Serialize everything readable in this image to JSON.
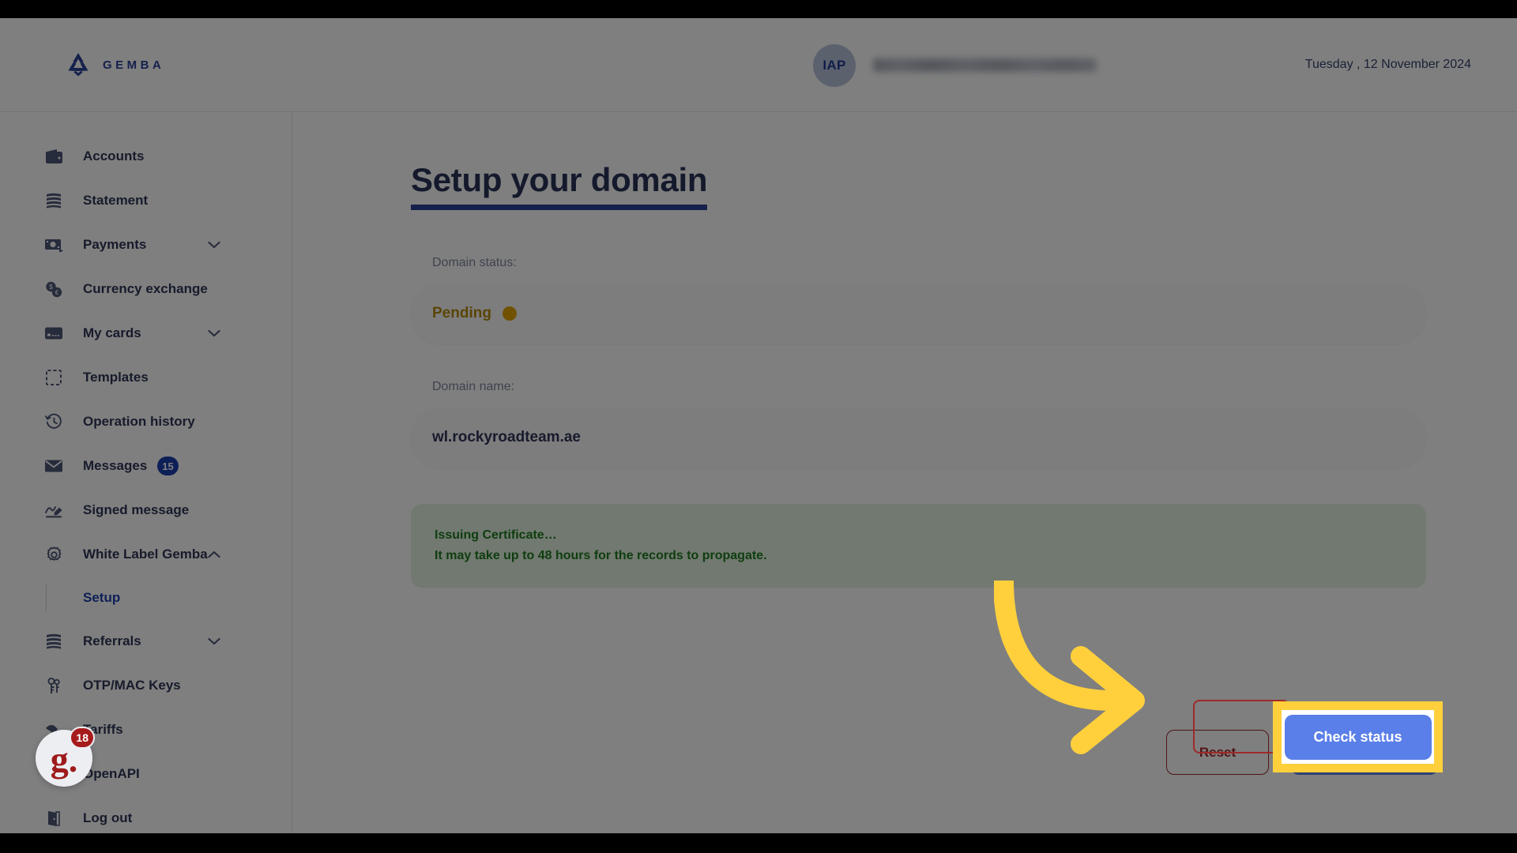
{
  "header": {
    "logo_text": "GEMBA",
    "logo_icon": "gemba-logo-icon",
    "avatar_initials": "IAP",
    "user_email_redacted": "",
    "date": "Tuesday , 12 November 2024"
  },
  "sidebar": {
    "items": [
      {
        "label": "Accounts",
        "icon": "wallet-icon",
        "badge": null,
        "chevron": null
      },
      {
        "label": "Statement",
        "icon": "document-stack-icon",
        "badge": null,
        "chevron": null
      },
      {
        "label": "Payments",
        "icon": "banknote-icon",
        "badge": null,
        "chevron": "down"
      },
      {
        "label": "Currency exchange",
        "icon": "coins-exchange-icon",
        "badge": null,
        "chevron": null
      },
      {
        "label": "My cards",
        "icon": "credit-card-icon",
        "badge": null,
        "chevron": "down"
      },
      {
        "label": "Templates",
        "icon": "dashed-square-icon",
        "badge": null,
        "chevron": null
      },
      {
        "label": "Operation history",
        "icon": "clock-history-icon",
        "badge": null,
        "chevron": null
      },
      {
        "label": "Messages",
        "icon": "envelope-icon",
        "badge": "15",
        "chevron": null
      },
      {
        "label": "Signed message",
        "icon": "signature-icon",
        "badge": null,
        "chevron": null
      },
      {
        "label": "White Label Gemba",
        "icon": "gear-icon",
        "badge": null,
        "chevron": "up"
      }
    ],
    "sub_item": {
      "label": "Setup",
      "active": true
    },
    "items_after": [
      {
        "label": "Referrals",
        "icon": "document-stack-icon",
        "badge": null,
        "chevron": "down"
      },
      {
        "label": "OTP/MAC Keys",
        "icon": "keys-icon",
        "badge": null,
        "chevron": null
      },
      {
        "label": "Tariffs",
        "icon": "price-tag-icon",
        "badge": null,
        "chevron": null
      },
      {
        "label": "OpenAPI",
        "icon": "api-icon",
        "badge": null,
        "chevron": null
      },
      {
        "label": "Log out",
        "icon": "exit-door-icon",
        "badge": null,
        "chevron": null
      }
    ]
  },
  "main": {
    "title": "Setup your domain",
    "status_label": "Domain status:",
    "status_value": "Pending",
    "status_dot_color": "#e0a400",
    "domain_label": "Domain name:",
    "domain_value": "wl.rockyroadteam.ae",
    "notice": {
      "line1": "Issuing Certificate…",
      "line2": "It may take up to 48 hours for the records to propagate."
    },
    "reset_button": "Reset",
    "check_status_button": "Check status"
  },
  "chat_widget": {
    "glyph": "g.",
    "badge": "18"
  },
  "annotations": {
    "arrow_color": "#ffd03c",
    "highlight_border_color": "#ffd03c",
    "redbox_color": "#9e2a2a"
  }
}
